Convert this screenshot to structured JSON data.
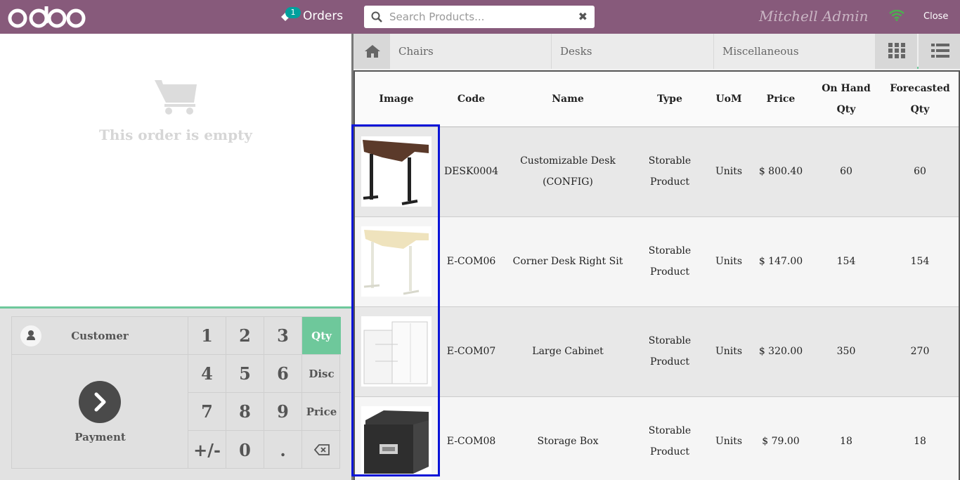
{
  "topbar": {
    "logo_text": "odoo",
    "orders_count": "1",
    "orders_label": "Orders",
    "search_placeholder": "Search Products...",
    "user_name": "Mitchell Admin",
    "close_label": "Close",
    "colors": {
      "brand": "#875a7b",
      "badge": "#00a09d",
      "wifi": "#4caf50"
    }
  },
  "order": {
    "empty_text": "This order is empty"
  },
  "pad": {
    "customer_label": "Customer",
    "payment_label": "Payment",
    "keys": [
      "1",
      "2",
      "3",
      "4",
      "5",
      "6",
      "7",
      "8",
      "9",
      "+/-",
      "0",
      "."
    ],
    "modes": [
      "Qty",
      "Disc",
      "Price"
    ],
    "active_mode": "Qty",
    "accent": "#6ec89b"
  },
  "categories": {
    "items": [
      "Chairs",
      "Desks",
      "Miscellaneous"
    ]
  },
  "products": {
    "headers": [
      "Image",
      "Code",
      "Name",
      "Type",
      "UoM",
      "Price",
      "On Hand Qty",
      "Forecasted Qty"
    ],
    "header_lines": {
      "onhand": [
        "On Hand",
        "Qty"
      ],
      "forecast": [
        "Forecasted",
        "Qty"
      ]
    },
    "rows": [
      {
        "image": "desk-dark-image",
        "code": "DESK0004",
        "name": [
          "Customizable Desk",
          "(CONFIG)"
        ],
        "type": [
          "Storable",
          "Product"
        ],
        "uom": "Units",
        "price": "$ 800.40",
        "onhand": "60",
        "forecast": "60"
      },
      {
        "image": "desk-light-image",
        "code": "E-COM06",
        "name": [
          "Corner Desk Right Sit"
        ],
        "type": [
          "Storable",
          "Product"
        ],
        "uom": "Units",
        "price": "$ 147.00",
        "onhand": "154",
        "forecast": "154"
      },
      {
        "image": "cabinet-image",
        "code": "E-COM07",
        "name": [
          "Large Cabinet"
        ],
        "type": [
          "Storable",
          "Product"
        ],
        "uom": "Units",
        "price": "$ 320.00",
        "onhand": "350",
        "forecast": "270"
      },
      {
        "image": "storage-box-image",
        "code": "E-COM08",
        "name": [
          "Storage Box"
        ],
        "type": [
          "Storable",
          "Product"
        ],
        "uom": "Units",
        "price": "$ 79.00",
        "onhand": "18",
        "forecast": "18"
      }
    ]
  }
}
